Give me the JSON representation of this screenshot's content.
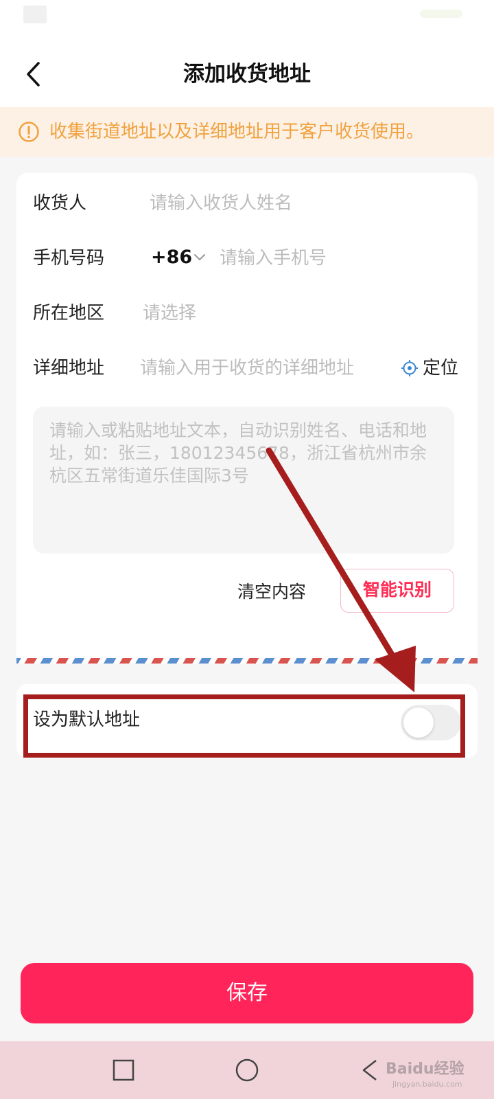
{
  "header": {
    "title": "添加收货地址",
    "back_icon": "chevron-left-icon"
  },
  "notice": {
    "text": "收集街道地址以及详细地址用于客户收货使用。",
    "icon": "warning-circle-icon",
    "color": "#f0a23e"
  },
  "form": {
    "recipient": {
      "label": "收货人",
      "placeholder": "请输入收货人姓名"
    },
    "phone": {
      "label": "手机号码",
      "country_code": "+86",
      "placeholder": "请输入手机号"
    },
    "region": {
      "label": "所在地区",
      "placeholder": "请选择"
    },
    "address": {
      "label": "详细地址",
      "placeholder": "请输入用于收货的详细地址",
      "locate_label": "定位",
      "locate_icon": "locate-target-icon"
    }
  },
  "paste": {
    "placeholder": "请输入或粘贴地址文本，自动识别姓名、电话和地址，如：张三，18012345678，浙江省杭州市余杭区五常街道乐佳国际3号",
    "clear_label": "清空内容",
    "smart_label": "智能识别"
  },
  "default_address": {
    "label": "设为默认地址",
    "toggle_on": false
  },
  "save_label": "保存",
  "watermark": {
    "main": "Baidu经验",
    "sub": "jingyan.baidu.com"
  },
  "colors": {
    "accent": "#ff2459",
    "annotation": "#a51d1d",
    "notice_bg": "#fdf1e6"
  }
}
